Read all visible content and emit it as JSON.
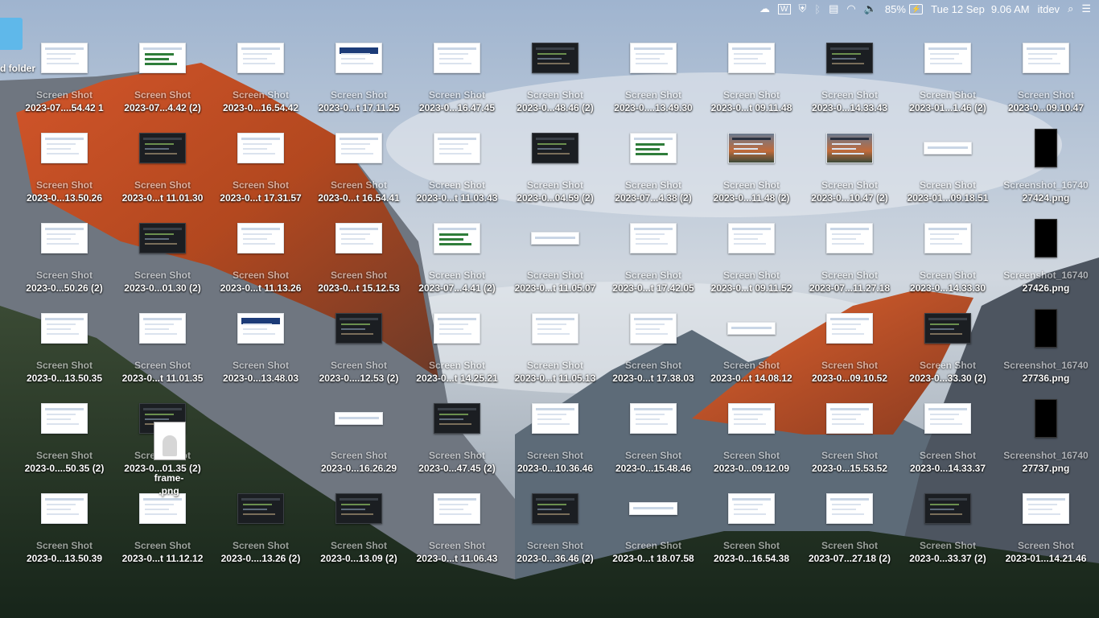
{
  "menubar": {
    "icons": [
      "creative-cloud-icon",
      "w-app-icon",
      "shield-lock-icon",
      "bluetooth-icon",
      "display-icon",
      "wifi-icon",
      "volume-icon"
    ],
    "battery": "85%",
    "datetime_day": "Tue 12 Sep",
    "datetime_time": "9.06 AM",
    "user": "itdev"
  },
  "left": {
    "folder_label": "d folder",
    "drag_label": "frame-\n.png"
  },
  "rows": [
    [
      {
        "l1": "Screen Shot",
        "l2": "2023-07....54.42 1",
        "k": "doc"
      },
      {
        "l1": "Screen Shot",
        "l2": "2023-07...4.42 (2)",
        "k": "green"
      },
      {
        "l1": "Screen Shot",
        "l2": "2023-0...16.54.42",
        "k": "doc"
      },
      {
        "l1": "Screen Shot",
        "l2": "2023-0...t 17.11.25",
        "k": "banner"
      },
      {
        "l1": "Screen Shot",
        "l2": "2023-0...16.47.45",
        "k": "doc"
      },
      {
        "l1": "Screen Shot",
        "l2": "2023-0...48.46 (2)",
        "k": "dark"
      },
      {
        "l1": "Screen Shot",
        "l2": "2023-0....13.49.30",
        "k": "doc"
      },
      {
        "l1": "Screen Shot",
        "l2": "2023-0...t 09.11.48",
        "k": "doc"
      },
      {
        "l1": "Screen Shot",
        "l2": "2023-0...14.33.43",
        "k": "dark"
      },
      {
        "l1": "Screen Shot",
        "l2": "2023-01...1.46 (2)",
        "k": "doc"
      },
      {
        "l1": "Screen Shot",
        "l2": "2023-0...09.10.47",
        "k": "doc"
      }
    ],
    [
      {
        "l1": "Screen Shot",
        "l2": "2023-0...13.50.26",
        "k": "doc"
      },
      {
        "l1": "Screen Shot",
        "l2": "2023-0...t 11.01.30",
        "k": "dark"
      },
      {
        "l1": "Screen Shot",
        "l2": "2023-0...t 17.31.57",
        "k": "doc"
      },
      {
        "l1": "Screen Shot",
        "l2": "2023-0...t 16.54.41",
        "k": "doc"
      },
      {
        "l1": "Screen Shot",
        "l2": "2023-0...t 11.03.43",
        "k": "doc"
      },
      {
        "l1": "Screen Shot",
        "l2": "2023-0...04.59 (2)",
        "k": "dark"
      },
      {
        "l1": "Screen Shot",
        "l2": "2023-07...4.38 (2)",
        "k": "green"
      },
      {
        "l1": "Screen Shot",
        "l2": "2023-0...11.48 (2)",
        "k": "photo"
      },
      {
        "l1": "Screen Shot",
        "l2": "2023-0...10.47 (2)",
        "k": "photo"
      },
      {
        "l1": "Screen Shot",
        "l2": "2023-01...09.18.51",
        "k": "wide"
      },
      {
        "l1": "Screenshot_16740",
        "l2": "27424.png",
        "k": "mobile"
      }
    ],
    [
      {
        "l1": "Screen Shot",
        "l2": "2023-0...50.26 (2)",
        "k": "doc"
      },
      {
        "l1": "Screen Shot",
        "l2": "2023-0...01.30 (2)",
        "k": "dark"
      },
      {
        "l1": "Screen Shot",
        "l2": "2023-0...t 11.13.26",
        "k": "doc"
      },
      {
        "l1": "Screen Shot",
        "l2": "2023-0...t 15.12.53",
        "k": "doc"
      },
      {
        "l1": "Screen Shot",
        "l2": "2023-07...4.41 (2)",
        "k": "green"
      },
      {
        "l1": "Screen Shot",
        "l2": "2023-0...t 11.05.07",
        "k": "wide"
      },
      {
        "l1": "Screen Shot",
        "l2": "2023-0...t 17.42.05",
        "k": "doc"
      },
      {
        "l1": "Screen Shot",
        "l2": "2023-0...t 09.11.52",
        "k": "doc"
      },
      {
        "l1": "Screen Shot",
        "l2": "2023-07...11.27.18",
        "k": "doc"
      },
      {
        "l1": "Screen Shot",
        "l2": "2023-0...14.33.30",
        "k": "doc"
      },
      {
        "l1": "Screenshot_16740",
        "l2": "27426.png",
        "k": "mobile"
      }
    ],
    [
      {
        "l1": "Screen Shot",
        "l2": "2023-0...13.50.35",
        "k": "doc"
      },
      {
        "l1": "Screen Shot",
        "l2": "2023-0...t 11.01.35",
        "k": "doc"
      },
      {
        "l1": "Screen Shot",
        "l2": "2023-0...13.48.03",
        "k": "banner"
      },
      {
        "l1": "Screen Shot",
        "l2": "2023-0....12.53 (2)",
        "k": "dark"
      },
      {
        "l1": "Screen Shot",
        "l2": "2023-0...t 14.25.21",
        "k": "doc"
      },
      {
        "l1": "Screen Shot",
        "l2": "2023-0...t 11.05.13",
        "k": "doc"
      },
      {
        "l1": "Screen Shot",
        "l2": "2023-0...t 17.38.03",
        "k": "doc"
      },
      {
        "l1": "Screen Shot",
        "l2": "2023-0...t 14.08.12",
        "k": "wide"
      },
      {
        "l1": "Screen Shot",
        "l2": "2023-0...09.10.52",
        "k": "doc"
      },
      {
        "l1": "Screen Shot",
        "l2": "2023-0...33.30 (2)",
        "k": "dark"
      },
      {
        "l1": "Screenshot_16740",
        "l2": "27736.png",
        "k": "mobile"
      }
    ],
    [
      {
        "l1": "Screen Shot",
        "l2": "2023-0....50.35 (2)",
        "k": "doc"
      },
      {
        "l1": "Screen Shot",
        "l2": "2023-0...01.35 (2)",
        "k": "dark"
      },
      null,
      {
        "l1": "Screen Shot",
        "l2": "2023-0...16.26.29",
        "k": "wide"
      },
      {
        "l1": "Screen Shot",
        "l2": "2023-0...47.45 (2)",
        "k": "dark"
      },
      {
        "l1": "Screen Shot",
        "l2": "2023-0...10.36.46",
        "k": "doc"
      },
      {
        "l1": "Screen Shot",
        "l2": "2023-0...15.48.46",
        "k": "doc"
      },
      {
        "l1": "Screen Shot",
        "l2": "2023-0...09.12.09",
        "k": "doc"
      },
      {
        "l1": "Screen Shot",
        "l2": "2023-0...15.53.52",
        "k": "doc"
      },
      {
        "l1": "Screen Shot",
        "l2": "2023-0...14.33.37",
        "k": "doc"
      },
      {
        "l1": "Screenshot_16740",
        "l2": "27737.png",
        "k": "mobile"
      }
    ],
    [
      {
        "l1": "Screen Shot",
        "l2": "2023-0...13.50.39",
        "k": "doc"
      },
      {
        "l1": "Screen Shot",
        "l2": "2023-0...t 11.12.12",
        "k": "doc"
      },
      {
        "l1": "Screen Shot",
        "l2": "2023-0....13.26 (2)",
        "k": "dark"
      },
      {
        "l1": "Screen Shot",
        "l2": "2023-0...13.09 (2)",
        "k": "dark"
      },
      {
        "l1": "Screen Shot",
        "l2": "2023-0...t 11.06.43",
        "k": "doc"
      },
      {
        "l1": "Screen Shot",
        "l2": "2023-0...36.46 (2)",
        "k": "dark"
      },
      {
        "l1": "Screen Shot",
        "l2": "2023-0...t 18.07.58",
        "k": "wide"
      },
      {
        "l1": "Screen Shot",
        "l2": "2023-0...16.54.38",
        "k": "doc"
      },
      {
        "l1": "Screen Shot",
        "l2": "2023-07...27.18 (2)",
        "k": "doc"
      },
      {
        "l1": "Screen Shot",
        "l2": "2023-0...33.37 (2)",
        "k": "dark"
      },
      {
        "l1": "Screen Shot",
        "l2": "2023-01...14.21.46",
        "k": "doc"
      }
    ]
  ]
}
